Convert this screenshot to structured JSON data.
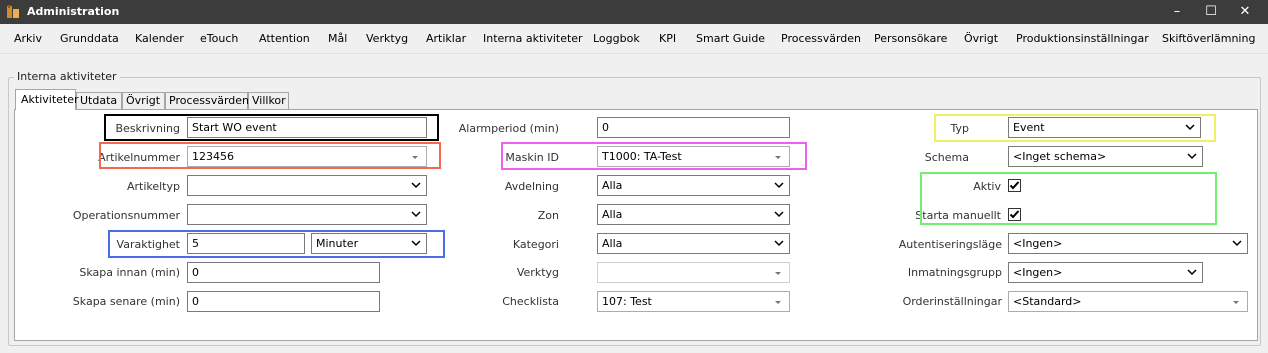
{
  "window": {
    "title": "Administration",
    "minimize": "–",
    "maximize": "☐",
    "close": "✕"
  },
  "menu": [
    "Arkiv",
    "Grunddata",
    "Kalender",
    "eTouch",
    "Attention",
    "Mål",
    "Verktyg",
    "Artiklar",
    "Interna aktiviteter",
    "Loggbok",
    "KPI",
    "Smart Guide",
    "Processvärden",
    "Personsökare",
    "Övrigt",
    "Produktionsinställningar",
    "Skiftöverlämning"
  ],
  "group_label": "Interna aktiviteter",
  "tabs": [
    "Aktiviteter",
    "Utdata",
    "Övrigt",
    "Processvärden",
    "Villkor"
  ],
  "col1": {
    "beskrivning": {
      "label": "Beskrivning",
      "value": "Start WO event"
    },
    "artikelnummer": {
      "label": "Artikelnummer",
      "value": "123456"
    },
    "artikeltyp": {
      "label": "Artikeltyp",
      "value": ""
    },
    "operationsnummer": {
      "label": "Operationsnummer",
      "value": ""
    },
    "varaktighet": {
      "label": "Varaktighet",
      "value": "5",
      "unit": "Minuter"
    },
    "skapa_innan": {
      "label": "Skapa innan (min)",
      "value": "0"
    },
    "skapa_senare": {
      "label": "Skapa senare (min)",
      "value": "0"
    }
  },
  "col2": {
    "alarmperiod": {
      "label": "Alarmperiod (min)",
      "value": "0"
    },
    "maskin_id": {
      "label": "Maskin ID",
      "value": "T1000: TA-Test"
    },
    "avdelning": {
      "label": "Avdelning",
      "value": "Alla"
    },
    "zon": {
      "label": "Zon",
      "value": "Alla"
    },
    "kategori": {
      "label": "Kategori",
      "value": "Alla"
    },
    "verktyg": {
      "label": "Verktyg",
      "value": ""
    },
    "checklista": {
      "label": "Checklista",
      "value": "107: Test"
    }
  },
  "col3": {
    "typ": {
      "label": "Typ",
      "value": "Event"
    },
    "schema": {
      "label": "Schema",
      "value": "<Inget schema>"
    },
    "aktiv": {
      "label": "Aktiv",
      "checked": true
    },
    "starta_manuellt": {
      "label": "Starta manuellt",
      "checked": true
    },
    "autentisering": {
      "label": "Autentiseringsläge",
      "value": "<Ingen>"
    },
    "inmatningsgrupp": {
      "label": "Inmatningsgrupp",
      "value": "<Ingen>"
    },
    "orderinstallningar": {
      "label": "Orderinställningar",
      "value": "<Standard>"
    }
  },
  "colors": {
    "titlebar": "#3c3c3c",
    "black_box": "#000000",
    "red_box": "#f06a50",
    "blue_box": "#4a6ee8",
    "magenta_box": "#f060f0",
    "yellow_box": "#f0f060",
    "green_box": "#70f070"
  }
}
